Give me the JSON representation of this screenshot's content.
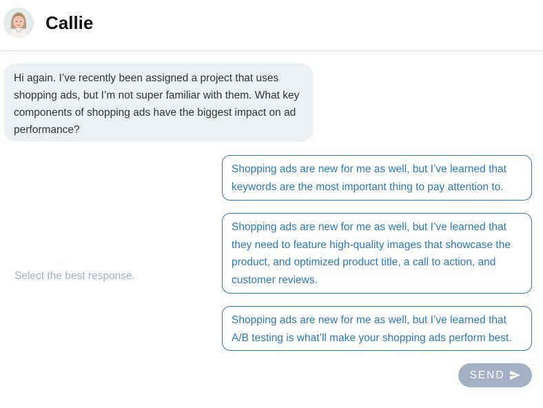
{
  "header": {
    "contact_name": "Callie",
    "avatar_icon": "woman-avatar-icon"
  },
  "conversation": {
    "incoming_message": "Hi again. I’ve recently been assigned a project that uses shopping ads, but I’m not super familiar with them. What key components of shopping ads have the biggest impact on ad performance?"
  },
  "response_picker": {
    "instruction": "Select the best response.",
    "options": [
      {
        "text": "Shopping ads are new for me as well, but I’ve learned that keywords are the most important thing to pay attention to."
      },
      {
        "text": "Shopping ads are new for me as well, but I’ve learned that they need to feature high-quality images that showcase the product, and optimized product title, a call to action, and customer reviews."
      },
      {
        "text": "Shopping ads are new for me as well, but I’ve learned that A/B testing is what’ll make your shopping ads perform best."
      }
    ]
  },
  "send_button": {
    "label": "SEND",
    "icon": "send-arrow-icon"
  },
  "colors": {
    "option_border": "#2b77b9",
    "option_text": "#2a79b8",
    "incoming_bubble": "#ecf0f3",
    "send_disabled": "#a2b1c3",
    "instruction_text": "#a3afbd"
  }
}
